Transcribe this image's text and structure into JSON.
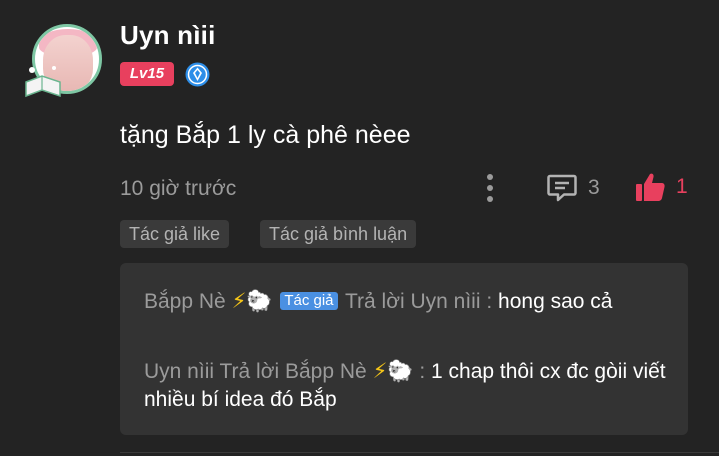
{
  "comment": {
    "username": "Uyn nìii",
    "level": "Lv15",
    "text": "tặng Bắp 1 ly cà phê nèee",
    "time": "10 giờ trước",
    "reply_count": "3",
    "like_count": "1",
    "tags": [
      "Tác giả like",
      "Tác giả bình luận"
    ]
  },
  "replies": [
    {
      "author": "Bắpp Nè",
      "author_badge": "Tác giả",
      "action": "Trả lời Uyn nìii :",
      "content": "hong sao cả"
    },
    {
      "author": "Uyn nìii",
      "action_prefix": "Trả lời Bắpp Nè",
      "action_suffix": ":",
      "content": "1 chap thôi cx đc gòii viết nhiều bí idea đó Bắp"
    }
  ],
  "icons": {
    "badge": "verified-diamond-icon",
    "more": "more-vertical-icon",
    "reply": "comment-icon",
    "like": "thumbs-up-icon",
    "emoji_bolt": "⚡",
    "emoji_sheep": "🐑"
  },
  "colors": {
    "background": "#232323",
    "accent_pink": "#e8405e",
    "author_badge": "#4a90e2",
    "muted_text": "#9b9b9b"
  }
}
